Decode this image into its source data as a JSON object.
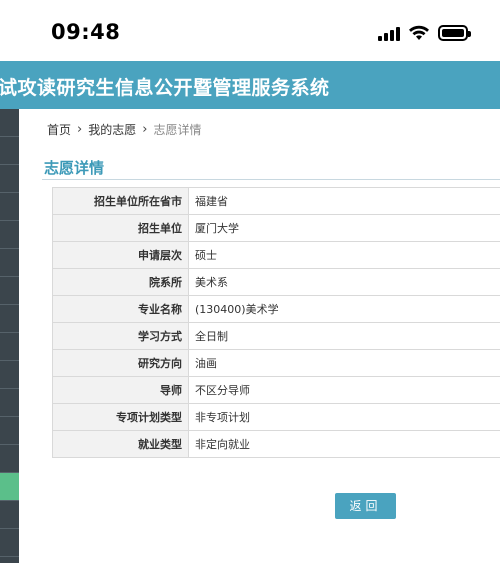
{
  "status_bar": {
    "time": "09:48"
  },
  "header": {
    "title": "试攻读研究生信息公开暨管理服务系统"
  },
  "breadcrumb": {
    "home": "首页",
    "level2": "我的志愿",
    "current": "志愿详情"
  },
  "section": {
    "title": "志愿详情"
  },
  "details": [
    {
      "label": "招生单位所在省市",
      "value": "福建省"
    },
    {
      "label": "招生单位",
      "value": "厦门大学"
    },
    {
      "label": "申请层次",
      "value": "硕士"
    },
    {
      "label": "院系所",
      "value": "美术系"
    },
    {
      "label": "专业名称",
      "value": "(130400)美术学"
    },
    {
      "label": "学习方式",
      "value": "全日制"
    },
    {
      "label": "研究方向",
      "value": "油画"
    },
    {
      "label": "导师",
      "value": "不区分导师"
    },
    {
      "label": "专项计划类型",
      "value": "非专项计划"
    },
    {
      "label": "就业类型",
      "value": "非定向就业"
    }
  ],
  "buttons": {
    "back": "返回"
  },
  "colors": {
    "accent": "#4aa3bf",
    "sidebar": "#3b454c",
    "sidebar_active": "#5bbf8a"
  },
  "icons": [
    "signal-icon",
    "wifi-icon",
    "battery-icon",
    "chevron-right-icon"
  ]
}
